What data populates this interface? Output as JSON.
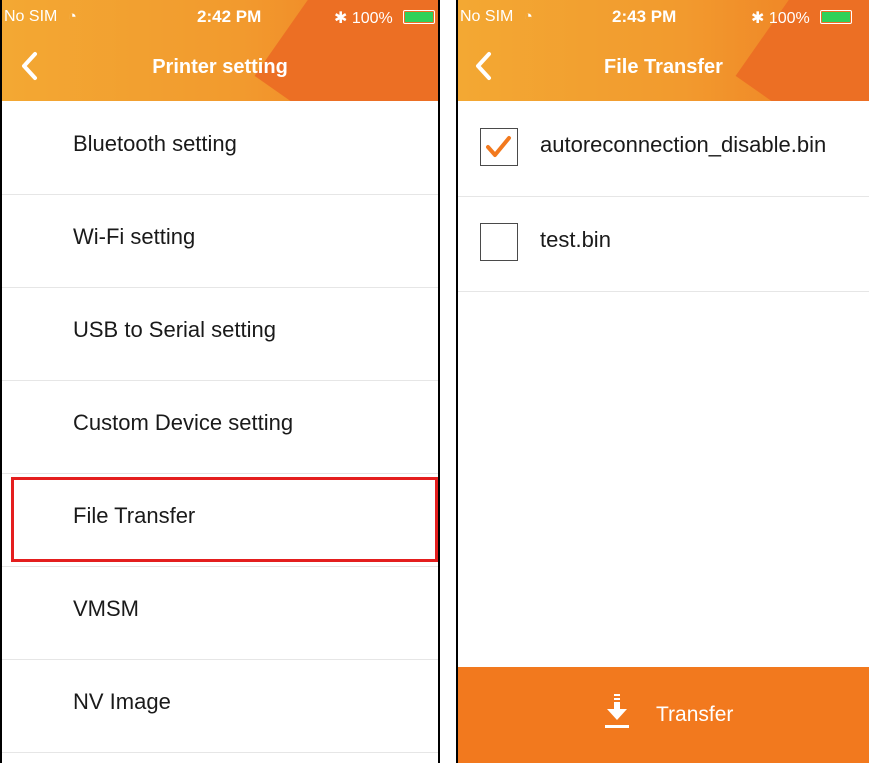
{
  "left_screen": {
    "status_bar": {
      "carrier": "No SIM",
      "time": "2:42 PM",
      "battery": "100%"
    },
    "header": {
      "title": "Printer setting"
    },
    "menu_items": [
      {
        "label": "Bluetooth setting"
      },
      {
        "label": "Wi-Fi setting"
      },
      {
        "label": "USB to Serial setting"
      },
      {
        "label": "Custom Device setting"
      },
      {
        "label": "File Transfer",
        "highlighted": true
      },
      {
        "label": "VMSM"
      },
      {
        "label": "NV Image"
      }
    ]
  },
  "right_screen": {
    "status_bar": {
      "carrier": "No SIM",
      "time": "2:43 PM",
      "battery": "100%"
    },
    "header": {
      "title": "File Transfer"
    },
    "files": [
      {
        "name": "autoreconnection_disable.bin",
        "checked": true
      },
      {
        "name": "test.bin",
        "checked": false
      }
    ],
    "transfer_button": {
      "label": "Transfer"
    }
  },
  "colors": {
    "header_start": "#f3a833",
    "header_end": "#ee7a22",
    "accent": "#f2791e",
    "highlight_border": "#e41e1e",
    "battery_green": "#2fd159"
  }
}
